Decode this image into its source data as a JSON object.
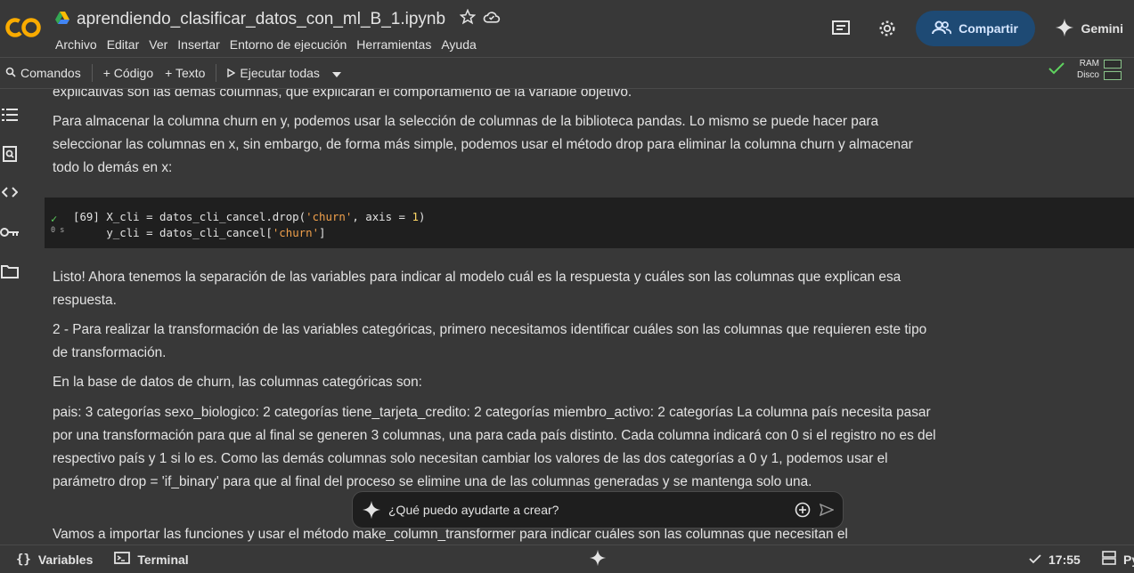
{
  "notebook": {
    "title": "aprendiendo_clasificar_datos_con_ml_B_1.ipynb"
  },
  "menu": [
    "Archivo",
    "Editar",
    "Ver",
    "Insertar",
    "Entorno de ejecución",
    "Herramientas",
    "Ayuda"
  ],
  "header": {
    "share_label": "Compartir",
    "gemini_label": "Gemini"
  },
  "toolbar": {
    "commands": "Comandos",
    "add_code": "+ Código",
    "add_text": "+ Texto",
    "run_all": "Ejecutar todas"
  },
  "resources": {
    "ram": "RAM",
    "disk": "Disco"
  },
  "content": {
    "para0": "explicativas son las demás columnas, que explicarán el comportamiento de la variable objetivo.",
    "para1": "Para almacenar la columna churn en y, podemos usar la selección de columnas de la biblioteca pandas. Lo mismo se puede hacer para seleccionar las columnas en x, sin embargo, de forma más simple, podemos usar el método drop para eliminar la columna churn y almacenar todo lo demás en x:",
    "code_cell": {
      "exec_count": "[69]",
      "exec_time": "0 s",
      "line1_a": "X_cli = datos_cli_cancel.drop(",
      "line1_str": "'churn'",
      "line1_b": ", axis = ",
      "line1_num": "1",
      "line1_c": ")",
      "line2_a": "y_cli = datos_cli_cancel[",
      "line2_str": "'churn'",
      "line2_b": "]"
    },
    "para2": "Listo! Ahora tenemos la separación de las variables para indicar al modelo cuál es la respuesta y cuáles son las columnas que explican esa respuesta.",
    "para3": "2 - Para realizar la transformación de las variables categóricas, primero necesitamos identificar cuáles son las columnas que requieren este tipo de transformación.",
    "para4": "En la base de datos de churn, las columnas categóricas son:",
    "para5": "pais: 3 categorías sexo_biologico: 2 categorías tiene_tarjeta_credito: 2 categorías miembro_activo: 2 categorías La columna país necesita pasar por una transformación para que al final se generen 3 columnas, una para cada país distinto. Cada columna indicará con 0 si el registro no es del respectivo país y 1 si lo es. Como las demás columnas solo necesitan cambiar los valores de las dos categorías a 0 y 1, podemos usar el parámetro drop = 'if_binary' para que al final del proceso se elimine una de las columnas generadas y se mantenga solo una.",
    "para6": "Vamos a importar las funciones y usar el método make_column_transformer para indicar cuáles son las columnas que necesitan el"
  },
  "prompt": {
    "placeholder": "¿Qué puedo ayudarte a crear?"
  },
  "statusbar": {
    "variables": "Variables",
    "terminal": "Terminal",
    "time": "17:55",
    "python": "Py"
  },
  "colors": {
    "background": "#383838",
    "share_button": "#1e4a74",
    "code_bg": "#1f1f1f",
    "success": "#5fd35f",
    "logo": "#f9ab00"
  }
}
